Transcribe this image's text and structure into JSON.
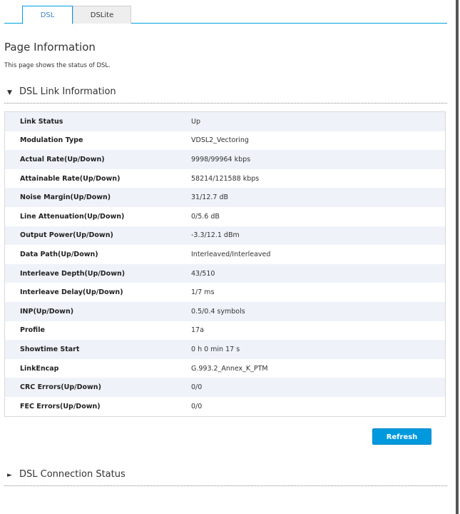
{
  "tabs": [
    {
      "label": "DSL",
      "active": true
    },
    {
      "label": "DSLite",
      "active": false
    }
  ],
  "page": {
    "title": "Page Information",
    "description": "This page shows the status of DSL."
  },
  "sections": {
    "link_info": {
      "label": "DSL Link Information",
      "expanded": true,
      "icon": "triangle-down-icon"
    },
    "connection_status": {
      "label": "DSL Connection Status",
      "expanded": false,
      "icon": "triangle-right-icon"
    }
  },
  "icons": {
    "expanded": "▼",
    "collapsed": "►"
  },
  "link_info_rows": [
    {
      "key": "Link Status",
      "value": "Up"
    },
    {
      "key": "Modulation Type",
      "value": "VDSL2_Vectoring"
    },
    {
      "key": "Actual Rate(Up/Down)",
      "value": "9998/99964 kbps"
    },
    {
      "key": "Attainable Rate(Up/Down)",
      "value": "58214/121588 kbps"
    },
    {
      "key": "Noise Margin(Up/Down)",
      "value": "31/12.7 dB"
    },
    {
      "key": "Line Attenuation(Up/Down)",
      "value": "0/5.6 dB"
    },
    {
      "key": "Output Power(Up/Down)",
      "value": "-3.3/12.1 dBm"
    },
    {
      "key": "Data Path(Up/Down)",
      "value": "Interleaved/Interleaved"
    },
    {
      "key": "Interleave Depth(Up/Down)",
      "value": "43/510"
    },
    {
      "key": "Interleave Delay(Up/Down)",
      "value": "1/7 ms"
    },
    {
      "key": "INP(Up/Down)",
      "value": "0.5/0.4 symbols"
    },
    {
      "key": "Profile",
      "value": "17a"
    },
    {
      "key": "Showtime Start",
      "value": "0 h 0 min 17 s"
    },
    {
      "key": "LinkEncap",
      "value": "G.993.2_Annex_K_PTM"
    },
    {
      "key": "CRC Errors(Up/Down)",
      "value": "0/0"
    },
    {
      "key": "FEC Errors(Up/Down)",
      "value": "0/0"
    }
  ],
  "buttons": {
    "refresh_label": "Refresh"
  },
  "colors": {
    "accent": "#00a0e0",
    "button": "#0099dd",
    "row_alt": "#eff3f9",
    "tab_inactive": "#eeeeee"
  }
}
